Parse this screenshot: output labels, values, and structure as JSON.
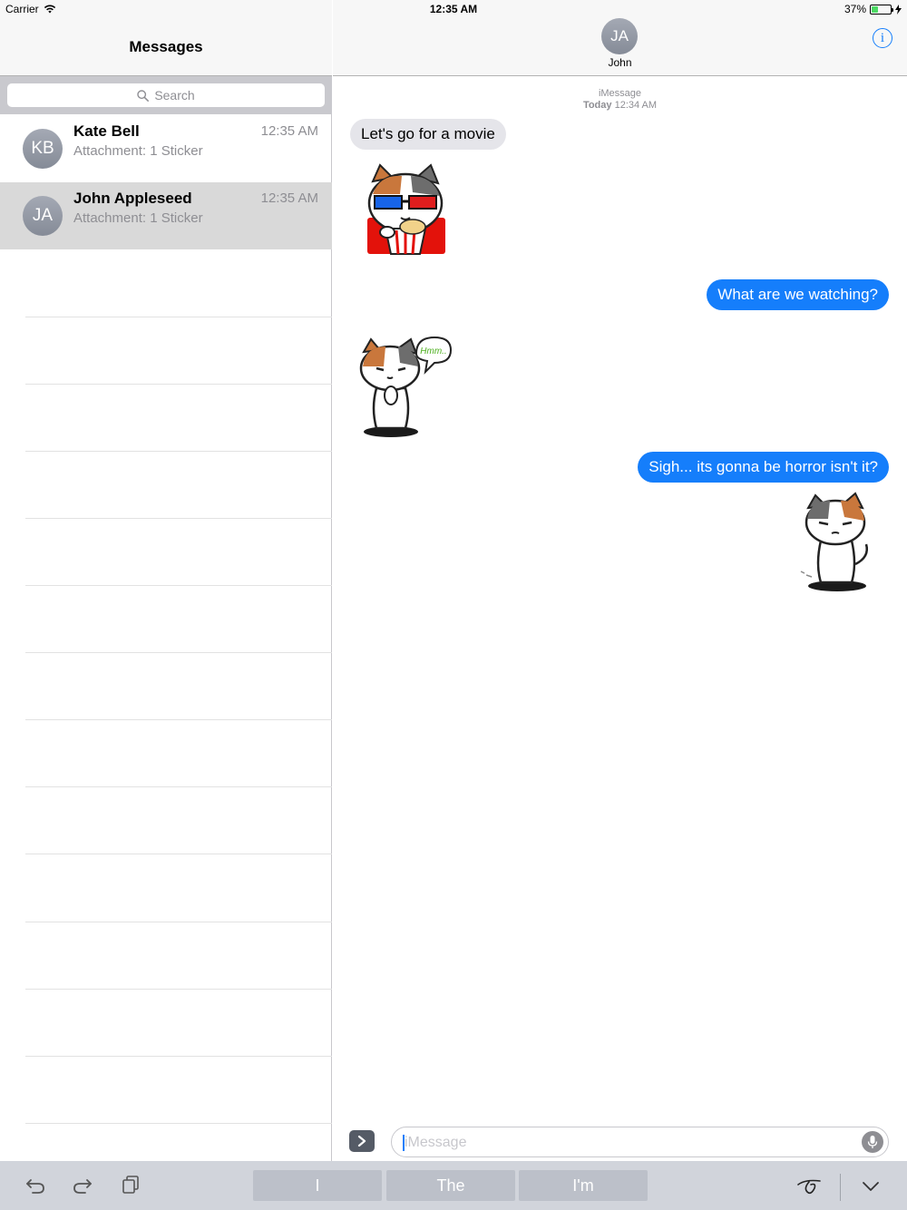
{
  "status_bar": {
    "carrier": "Carrier",
    "time": "12:35 AM",
    "battery_text": "37%",
    "battery_level": 0.37
  },
  "sidebar": {
    "title": "Messages",
    "search_placeholder": "Search",
    "conversations": [
      {
        "initials": "KB",
        "name": "Kate Bell",
        "preview": "Attachment: 1 Sticker",
        "time": "12:35 AM",
        "selected": false
      },
      {
        "initials": "JA",
        "name": "John Appleseed",
        "preview": "Attachment: 1 Sticker",
        "time": "12:35 AM",
        "selected": true
      }
    ]
  },
  "chat": {
    "contact_initials": "JA",
    "contact_name": "John",
    "service": "iMessage",
    "date_label": "Today",
    "date_time": "12:34 AM",
    "messages": [
      {
        "direction": "in",
        "type": "text",
        "text": "Let's go for a movie"
      },
      {
        "direction": "in",
        "type": "sticker",
        "sticker": "cat-3d-glasses-popcorn"
      },
      {
        "direction": "out",
        "type": "text",
        "text": "What are we watching?"
      },
      {
        "direction": "in",
        "type": "sticker",
        "sticker": "cat-thinking",
        "sticker_text": "Hmm.."
      },
      {
        "direction": "out",
        "type": "text",
        "text": "Sigh... its gonna be horror isn't it?"
      },
      {
        "direction": "out",
        "type": "sticker",
        "sticker": "cat-sighing"
      }
    ],
    "composer_placeholder": "iMessage"
  },
  "keyboard_bar": {
    "suggestions": [
      "I",
      "The",
      "I'm"
    ]
  },
  "colors": {
    "accent": "#157efb",
    "incoming_bubble": "#e5e5ea",
    "selected_row": "#d9d9d9"
  }
}
